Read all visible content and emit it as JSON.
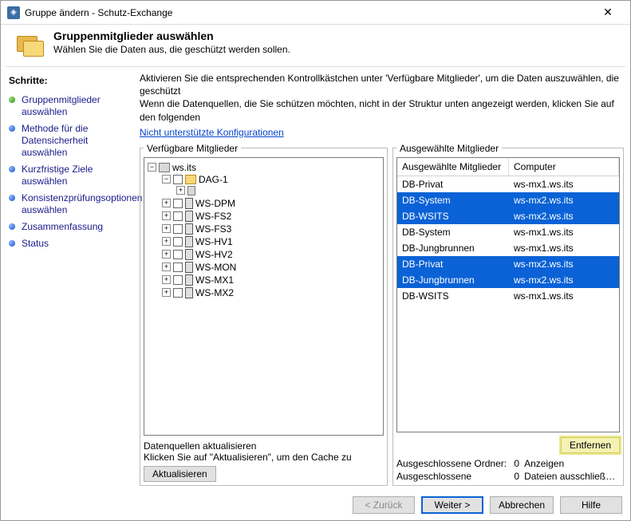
{
  "window": {
    "title": "Gruppe ändern - Schutz-Exchange"
  },
  "header": {
    "title": "Gruppenmitglieder auswählen",
    "subtitle": "Wählen Sie die Daten aus, die geschützt werden sollen."
  },
  "steps_title": "Schritte:",
  "steps": [
    {
      "label": "Gruppenmitglieder auswählen",
      "state": "green"
    },
    {
      "label": "Methode für die Datensicherheit auswählen",
      "state": "blue"
    },
    {
      "label": "Kurzfristige Ziele auswählen",
      "state": "blue"
    },
    {
      "label": "Konsistenzprüfungsoptionen auswählen",
      "state": "blue"
    },
    {
      "label": "Zusammenfassung",
      "state": "blue"
    },
    {
      "label": "Status",
      "state": "blue"
    }
  ],
  "intro": "Aktivieren Sie die entsprechenden Kontrollkästchen unter 'Verfügbare Mitglieder', um die Daten auszuwählen, die geschützt\nWenn die Datenquellen, die Sie schützen möchten, nicht in der Struktur unten angezeigt werden, klicken Sie auf den folgenden",
  "link": "Nicht unterstützte Konfigurationen",
  "available": {
    "legend": "Verfügbare Mitglieder",
    "root": "ws.its",
    "dag": "DAG-1",
    "nodes": [
      "WS-DPM",
      "WS-FS2",
      "WS-FS3",
      "WS-HV1",
      "WS-HV2",
      "WS-MON",
      "WS-MX1",
      "WS-MX2"
    ],
    "refresh_title": "Datenquellen aktualisieren",
    "refresh_hint": "Klicken Sie auf \"Aktualisieren\", um den Cache zu",
    "refresh_btn": "Aktualisieren"
  },
  "selected": {
    "legend": "Ausgewählte Mitglieder",
    "col1": "Ausgewählte Mitglieder",
    "col2": "Computer",
    "rows": [
      {
        "name": "DB-Privat",
        "comp": "ws-mx1.ws.its",
        "sel": false
      },
      {
        "name": "DB-System",
        "comp": "ws-mx2.ws.its",
        "sel": true
      },
      {
        "name": "DB-WSITS",
        "comp": "ws-mx2.ws.its",
        "sel": true
      },
      {
        "name": "DB-System",
        "comp": "ws-mx1.ws.its",
        "sel": false
      },
      {
        "name": "DB-Jungbrunnen",
        "comp": "ws-mx1.ws.its",
        "sel": false
      },
      {
        "name": "DB-Privat",
        "comp": "ws-mx2.ws.its",
        "sel": true
      },
      {
        "name": "DB-Jungbrunnen",
        "comp": "ws-mx2.ws.its",
        "sel": true
      },
      {
        "name": "DB-WSITS",
        "comp": "ws-mx1.ws.its",
        "sel": false
      }
    ],
    "remove_btn": "Entfernen",
    "excluded_folders_label": "Ausgeschlossene Ordner:",
    "excluded_folders_count": "0",
    "excluded_folders_action": "Anzeigen",
    "excluded_label": "Ausgeschlossene",
    "excluded_count": "0",
    "excluded_action": "Dateien ausschließen..."
  },
  "footer": {
    "back": "< Zurück",
    "next": "Weiter >",
    "cancel": "Abbrechen",
    "help": "Hilfe"
  }
}
